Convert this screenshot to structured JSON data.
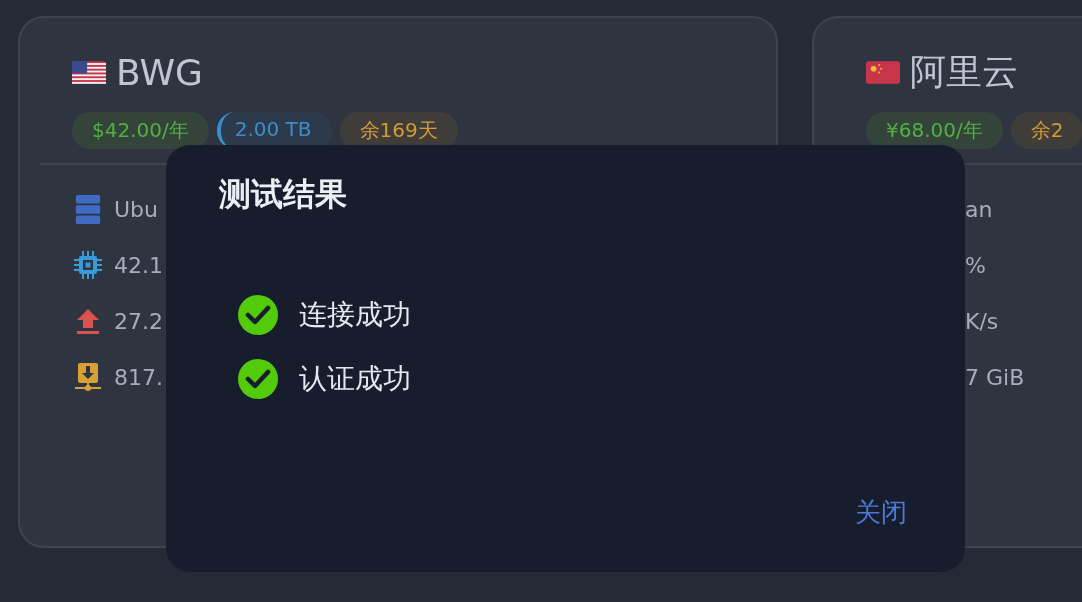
{
  "cards": [
    {
      "flag": {
        "kind": "us"
      },
      "title": "BWG",
      "badges": [
        {
          "kind": "price",
          "text": "$42.00/年"
        },
        {
          "kind": "traffic",
          "text": "2.00 TB"
        },
        {
          "kind": "days",
          "text": "余169天"
        }
      ],
      "rows": [
        {
          "kind": "os",
          "text": "Ubu"
        },
        {
          "kind": "cpu",
          "text": "42.1"
        },
        {
          "kind": "upload",
          "text": "27.2"
        },
        {
          "kind": "download",
          "text": "817."
        }
      ]
    },
    {
      "flag": {
        "kind": "cn"
      },
      "title": "阿里云",
      "badges": [
        {
          "kind": "price",
          "text": "¥68.00/年"
        },
        {
          "kind": "days",
          "text": "余2"
        }
      ],
      "rows": [
        {
          "text": "an"
        },
        {
          "text": "%"
        },
        {
          "text": "K/s"
        },
        {
          "text": "7 GiB"
        }
      ]
    }
  ],
  "dialog": {
    "title": "测试结果",
    "results": [
      {
        "text": "连接成功",
        "ok": true
      },
      {
        "text": "认证成功",
        "ok": true
      }
    ],
    "close_button": "关闭"
  }
}
